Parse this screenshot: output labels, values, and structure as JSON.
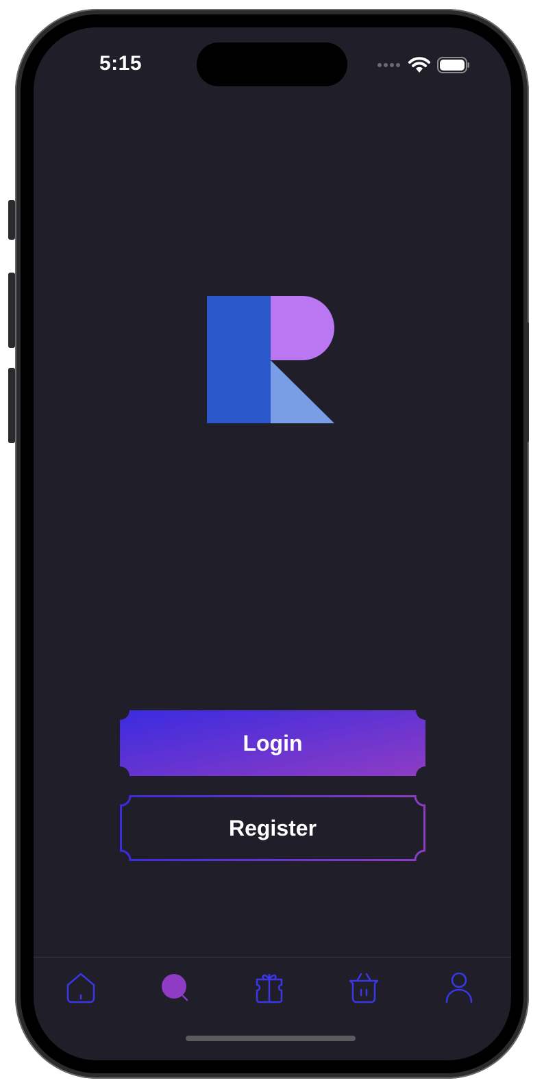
{
  "status_bar": {
    "time": "5:15"
  },
  "actions": {
    "login_label": "Login",
    "register_label": "Register"
  },
  "tab_bar": {
    "items": [
      {
        "icon": "home-icon"
      },
      {
        "icon": "search-icon",
        "active": true
      },
      {
        "icon": "gift-icon"
      },
      {
        "icon": "basket-icon"
      },
      {
        "icon": "user-icon"
      }
    ]
  },
  "colors": {
    "background": "#1f1e29",
    "gradient_start": "#3a2be0",
    "gradient_end": "#8e3cc4",
    "logo_blue": "#2a57c9",
    "logo_purple": "#bb77f2",
    "logo_light_blue": "#7a9ee6",
    "tab_icon": "#3a37e6",
    "tab_active": "#8e3cc4"
  }
}
